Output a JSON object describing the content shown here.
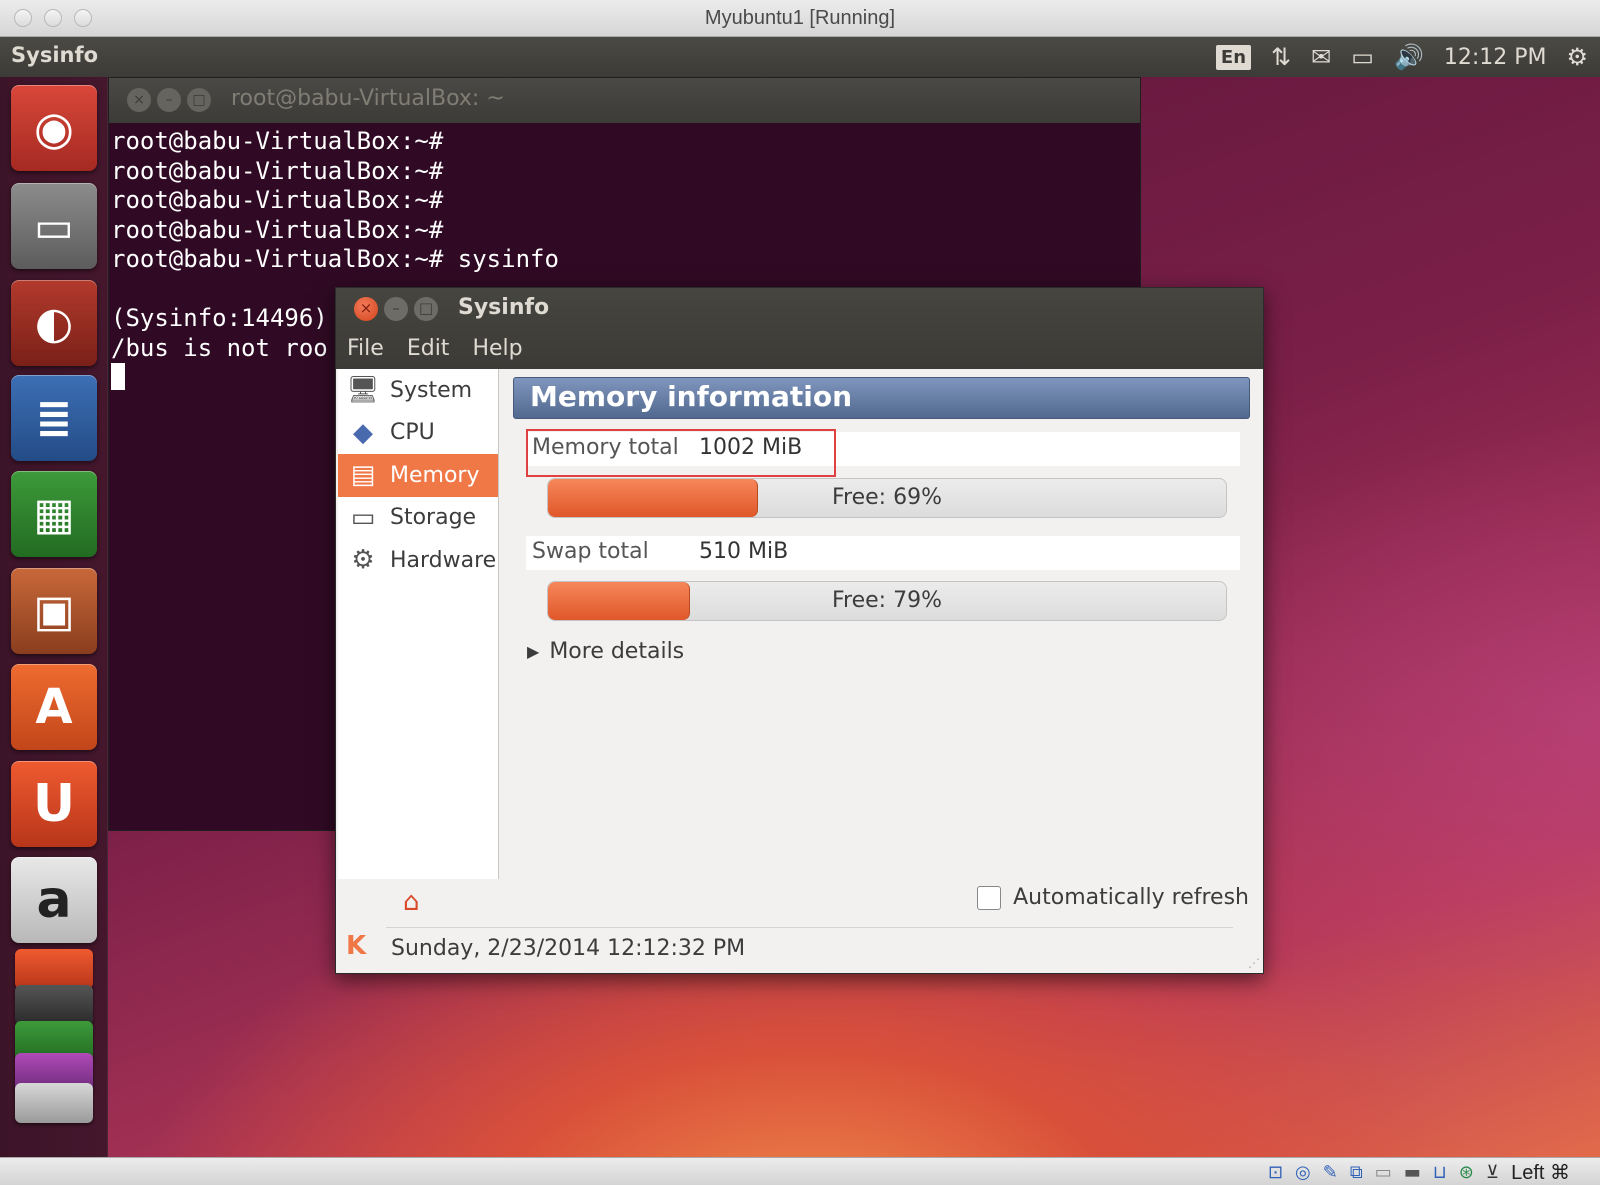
{
  "host_window": {
    "title": "Myubuntu1 [Running]"
  },
  "top_panel": {
    "app_name": "Sysinfo",
    "keyboard_layout": "En",
    "clock": "12:12 PM",
    "icons": [
      "network-icon",
      "mail-icon",
      "battery-icon",
      "volume-icon",
      "system-gear-icon"
    ]
  },
  "launcher": {
    "items": [
      {
        "name": "Dash Home",
        "glyph": "◉"
      },
      {
        "name": "Files",
        "glyph": "▭"
      },
      {
        "name": "Firefox",
        "glyph": "◐"
      },
      {
        "name": "LibreOffice Writer",
        "glyph": "≣"
      },
      {
        "name": "LibreOffice Calc",
        "glyph": "▦"
      },
      {
        "name": "LibreOffice Impress",
        "glyph": "▣"
      },
      {
        "name": "Ubuntu Software Center",
        "glyph": "A"
      },
      {
        "name": "Ubuntu One",
        "glyph": "U"
      },
      {
        "name": "Amazon",
        "glyph": "a"
      }
    ]
  },
  "terminal": {
    "title": "root@babu-VirtualBox: ~",
    "lines": [
      "root@babu-VirtualBox:~#",
      "root@babu-VirtualBox:~#",
      "root@babu-VirtualBox:~#",
      "root@babu-VirtualBox:~#",
      "root@babu-VirtualBox:~# sysinfo",
      "",
      "(Sysinfo:14496)",
      "/bus is not roo"
    ]
  },
  "sysinfo": {
    "title": "Sysinfo",
    "menu": [
      "File",
      "Edit",
      "Help"
    ],
    "sidebar": [
      {
        "label": "System",
        "icon": "monitor-icon",
        "glyph": "🖥",
        "active": false
      },
      {
        "label": "CPU",
        "icon": "cpu-icon",
        "glyph": "◆",
        "active": false
      },
      {
        "label": "Memory",
        "icon": "memory-icon",
        "glyph": "▤",
        "active": true
      },
      {
        "label": "Storage",
        "icon": "storage-icon",
        "glyph": "▭",
        "active": false
      },
      {
        "label": "Hardware",
        "icon": "hardware-gear-icon",
        "glyph": "⚙",
        "active": false
      }
    ],
    "section_title": "Memory information",
    "memory_total_label": "Memory total",
    "memory_total_value": "1002 MiB",
    "memory_free_text": "Free: 69%",
    "memory_used_fraction": 0.31,
    "swap_total_label": "Swap total",
    "swap_total_value": "510 MiB",
    "swap_free_text": "Free: 79%",
    "swap_used_fraction": 0.21,
    "more_details": "More details",
    "auto_refresh_label": "Automatically refresh",
    "auto_refresh_checked": false,
    "status_text": "Sunday, 2/23/2014 12:12:32 PM"
  },
  "vbox_status": {
    "host_key": "Left ⌘",
    "icons": [
      "hard-disk-icon",
      "optical-drive-icon",
      "usb-icon",
      "network-adapter-icon",
      "shared-folder-icon",
      "display-icon",
      "video-capture-icon",
      "mouse-integration-icon",
      "keyboard-capture-icon"
    ]
  },
  "colors": {
    "accent": "#f07746",
    "terminal_bg": "#300a24",
    "panel_bg": "#3c3b37",
    "header_blue": "#52698f",
    "highlight_red": "#e04040"
  }
}
